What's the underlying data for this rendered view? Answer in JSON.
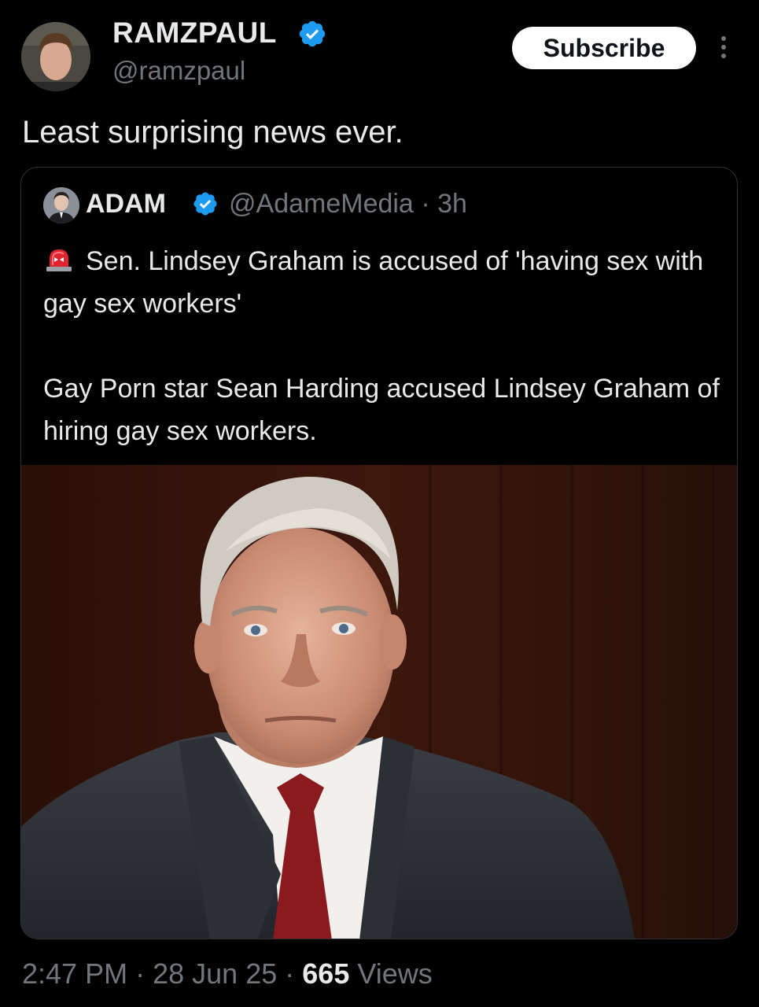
{
  "author": {
    "display_name": "RAMZPAUL",
    "handle": "@ramzpaul",
    "verified": true
  },
  "actions": {
    "subscribe_label": "Subscribe"
  },
  "tweet": {
    "text": "Least surprising news ever."
  },
  "quote": {
    "display_name": "ADAM",
    "handle": "@AdameMedia",
    "separator": "·",
    "age": "3h",
    "siren_icon": "police-siren-emoji",
    "line1": "Sen. Lindsey Graham is accused of 'having sex with gay sex workers'",
    "line2": "Gay Porn star Sean Harding accused Lindsey Graham of hiring gay sex workers."
  },
  "meta": {
    "time": "2:47 PM",
    "separator": "·",
    "date": "28 Jun 25",
    "views_count": "665",
    "views_label": "Views"
  },
  "colors": {
    "background": "#000000",
    "primary_text": "#e7e9ea",
    "secondary_text": "#71767b",
    "verified_blue": "#1d9bf0",
    "border": "#2f3336"
  }
}
